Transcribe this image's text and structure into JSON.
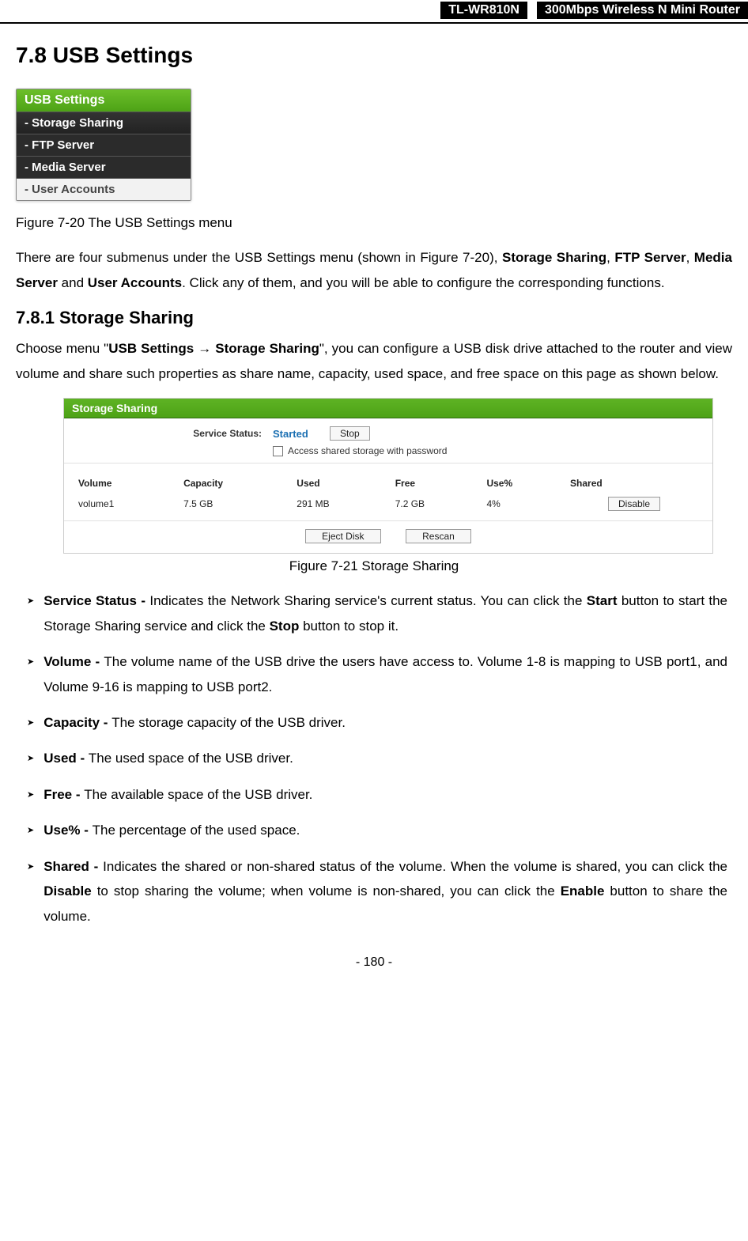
{
  "header": {
    "model": "TL-WR810N",
    "description": "300Mbps Wireless N Mini Router"
  },
  "section_title": "7.8  USB Settings",
  "menu": {
    "header": "USB Settings",
    "items": [
      {
        "label": "- Storage Sharing",
        "class": "current"
      },
      {
        "label": "- FTP Server",
        "class": "dark"
      },
      {
        "label": "- Media Server",
        "class": "dark"
      },
      {
        "label": "- User Accounts",
        "class": "light"
      }
    ]
  },
  "fig_7_20_caption": "Figure 7-20 The USB Settings menu",
  "intro_paragraph": {
    "pre": "There are four submenus under the USB Settings menu (shown in Figure 7-20), ",
    "b1": "Storage Sharing",
    "mid1": ", ",
    "b2": "FTP Server",
    "mid2": ", ",
    "b3": "Media Server",
    "mid3": " and ",
    "b4": "User Accounts",
    "post": ". Click any of them, and you will be able to configure the corresponding functions."
  },
  "subsection_title": "7.8.1  Storage Sharing",
  "storage_paragraph": {
    "pre": "Choose menu \"",
    "b1": "USB Settings",
    "arrow": " → ",
    "b2": "Storage Sharing",
    "post": "\", you can configure a USB disk drive attached to the router and view volume and share such properties as share name, capacity, used space, and free space on this page as shown below."
  },
  "storage_panel": {
    "title": "Storage Sharing",
    "status_label": "Service Status:",
    "status_value": "Started",
    "stop_button": "Stop",
    "checkbox_label": "Access shared storage with password",
    "columns": [
      "Volume",
      "Capacity",
      "Used",
      "Free",
      "Use%",
      "Shared"
    ],
    "rows": [
      {
        "volume": "volume1",
        "capacity": "7.5 GB",
        "used": "291 MB",
        "free": "7.2 GB",
        "usepct": "4%",
        "shared_btn": "Disable"
      }
    ],
    "eject_button": "Eject Disk",
    "rescan_button": "Rescan"
  },
  "fig_7_21_caption": "Figure 7-21 Storage Sharing",
  "bullets": [
    {
      "term": "Service Status - ",
      "text_pre": "Indicates the Network Sharing service's current status. You can click the ",
      "b1": "Start",
      "mid1": " button to start the Storage Sharing service and click the ",
      "b2": "Stop",
      "post": " button to stop it."
    },
    {
      "term": "Volume - ",
      "text": "The volume name of the USB drive the users have access to. Volume 1-8 is mapping to USB port1, and Volume 9-16 is mapping to USB port2."
    },
    {
      "term": "Capacity - ",
      "text": "The storage capacity of the USB driver."
    },
    {
      "term": "Used - ",
      "text": "The used space of the USB driver."
    },
    {
      "term": "Free - ",
      "text": "The available space of the USB driver."
    },
    {
      "term": "Use% - ",
      "text": "The percentage of the used space."
    },
    {
      "term": "Shared - ",
      "text_pre": "Indicates the shared or non-shared status of the volume. When the volume is shared, you can click the ",
      "b1": "Disable",
      "mid1": " to stop sharing the volume; when volume is non-shared, you can click the ",
      "b2": "Enable",
      "post": " button to share the volume."
    }
  ],
  "page_number": "- 180 -"
}
